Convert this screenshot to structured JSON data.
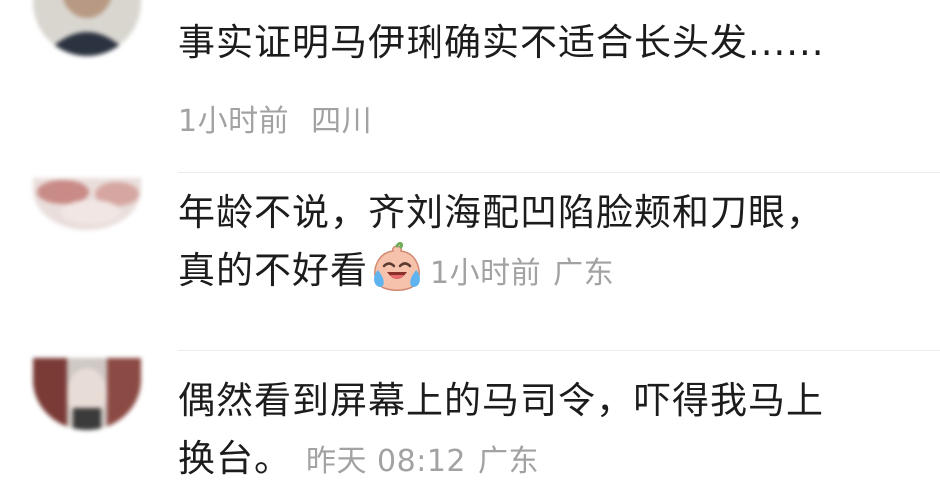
{
  "comments": [
    {
      "text": "事实证明马伊琍确实不适合长头发......",
      "time": "1小时前",
      "location": "四川"
    },
    {
      "text_line1": "年龄不说，齐刘海配凹陷脸颊和刀眼，",
      "text_line2": "真的不好看",
      "emoji": "crying-laughing-face-icon",
      "time": "1小时前",
      "location": "广东"
    },
    {
      "text_line1": "偶然看到屏幕上的马司令，吓得我马上",
      "text_line2": "换台。",
      "time": "昨天 08:12",
      "location": "广东"
    }
  ],
  "colors": {
    "text": "#1c1c1c",
    "meta": "#a2a2a2",
    "separator": "#ececec"
  }
}
